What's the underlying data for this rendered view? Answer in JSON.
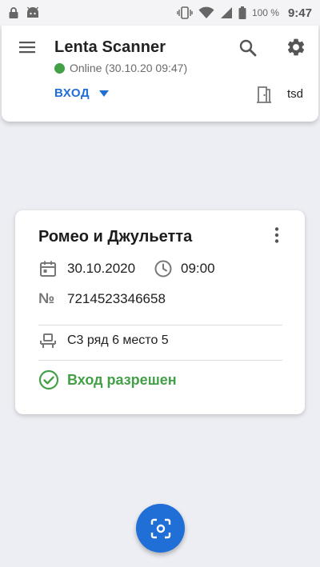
{
  "status_bar": {
    "battery_percent": "100 %",
    "time": "9:47",
    "icons": [
      "lock-icon",
      "android-icon",
      "vibrate-icon",
      "wifi-icon",
      "signal-icon",
      "battery-icon"
    ]
  },
  "app_bar": {
    "title": "Lenta Scanner",
    "status_text": "Online (30.10.20 09:47)",
    "status_color": "#43a047",
    "mode_label": "ВХОД",
    "device_name": "tsd",
    "icons": [
      "menu-icon",
      "search-icon",
      "gear-icon",
      "door-icon",
      "caret-down-icon"
    ]
  },
  "ticket": {
    "title": "Ромео и Джульетта",
    "date": "30.10.2020",
    "time": "09:00",
    "number_sign": "№",
    "number": "7214523346658",
    "seat": "С3 ряд 6 место 5",
    "access_status": "Вход разрешен",
    "access_color": "#43a047",
    "icons": [
      "calendar-icon",
      "clock-icon",
      "seat-icon",
      "check-circle-icon",
      "more-vert-icon"
    ]
  },
  "fab": {
    "icon": "scan-icon",
    "color": "#1f6fd6"
  },
  "colors": {
    "accent": "#1f6fd6",
    "success": "#43a047",
    "background": "#eceef3"
  }
}
